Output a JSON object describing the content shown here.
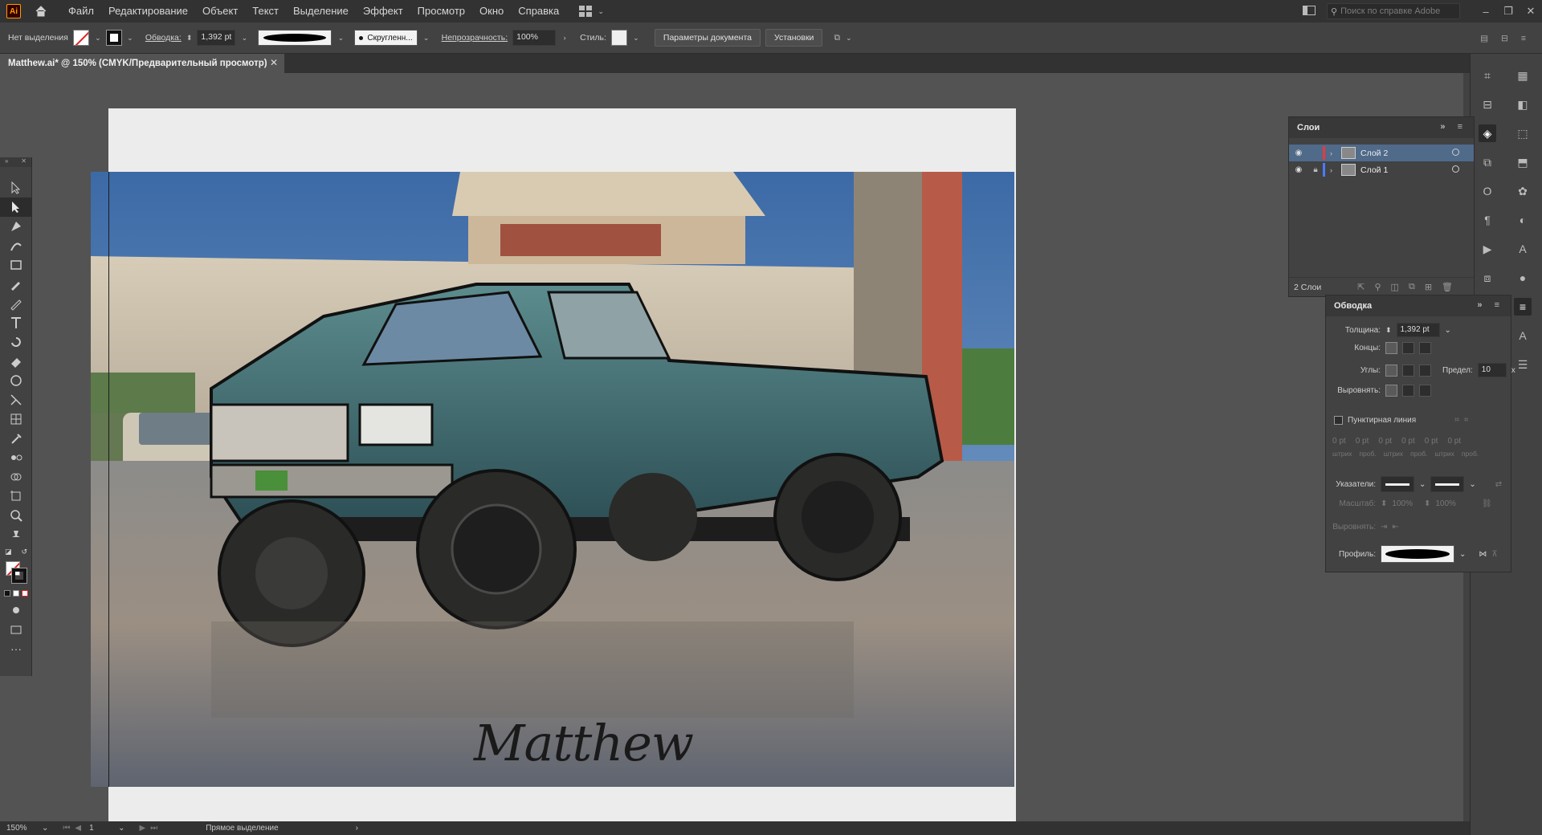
{
  "menubar": {
    "app_logo": "Ai",
    "items": [
      "Файл",
      "Редактирование",
      "Объект",
      "Текст",
      "Выделение",
      "Эффект",
      "Просмотр",
      "Окно",
      "Справка"
    ],
    "search_placeholder": "Поиск по справке Adobe"
  },
  "control": {
    "selection_label": "Нет выделения",
    "stroke_label": "Обводка:",
    "stroke_value": "1,392 pt",
    "brush_name": "Скругленн...",
    "opacity_label": "Непрозрачность:",
    "opacity_value": "100%",
    "styles_label": "Стиль:",
    "doc_setup_button": "Параметры документа",
    "prefs_button": "Установки"
  },
  "document": {
    "tab_title": "Matthew.ai* @ 150% (CMYK/Предварительный просмотр)",
    "artwork_signature": "Matthew"
  },
  "layers_panel": {
    "title": "Слои",
    "layers": [
      {
        "name": "Слой 2",
        "color": "#e8383d",
        "selected": true,
        "locked": false
      },
      {
        "name": "Слой 1",
        "color": "#4a7bff",
        "selected": false,
        "locked": true
      }
    ],
    "footer_count": "2 Слои"
  },
  "stroke_panel": {
    "title": "Обводка",
    "weight_label": "Толщина:",
    "weight_value": "1,392 pt",
    "cap_label": "Концы:",
    "corner_label": "Углы:",
    "limit_label": "Предел:",
    "limit_value": "10",
    "limit_unit": "x",
    "align_label": "Выровнять:",
    "dashed_label": "Пунктирная линия",
    "dash_fields": [
      "0 pt",
      "0 pt",
      "0 pt",
      "0 pt",
      "0 pt",
      "0 pt"
    ],
    "dash_sublabels": [
      "штрих",
      "проб.",
      "штрих",
      "проб.",
      "штрих",
      "проб."
    ],
    "arrowheads_label": "Указатели:",
    "scale_label": "Масштаб:",
    "scale_values": [
      "100%",
      "100%"
    ],
    "arrow_align_label": "Выровнять:",
    "profile_label": "Профиль:"
  },
  "status": {
    "zoom": "150%",
    "artboard_num": "1",
    "tool_name": "Прямое выделение"
  }
}
